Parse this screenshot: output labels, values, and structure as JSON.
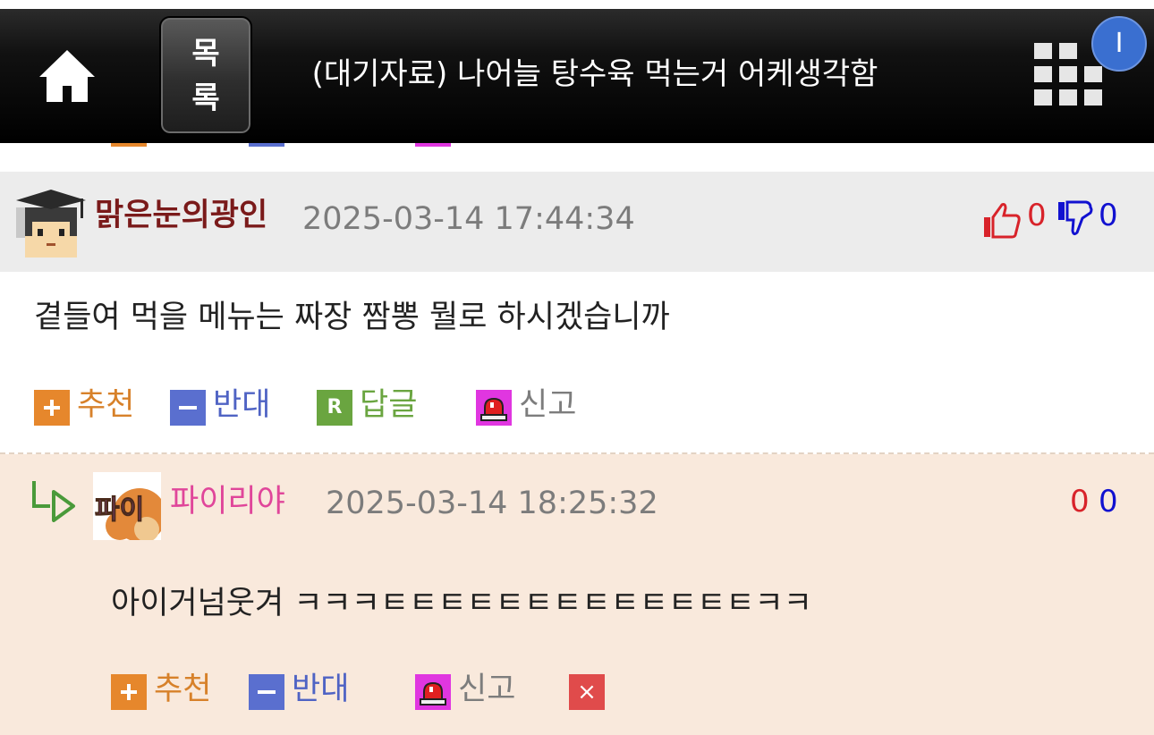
{
  "header": {
    "home_icon": "home-icon",
    "list_button": [
      "목",
      "록"
    ],
    "title": "(대기자료) 나어늘 탕수육 먹는거 어케생각함",
    "grid_icon": "grid-menu-icon",
    "user_badge": "I"
  },
  "comments": [
    {
      "nickname": "맑은눈의광인",
      "datetime": "2025-03-14 17:44:34",
      "upvotes": "0",
      "downvotes": "0",
      "body": "곁들여 먹을 메뉴는 짜장 짬뽕 뭘로 하시겠습니까",
      "actions": {
        "recommend": "추천",
        "oppose": "반대",
        "reply": "답글",
        "report": "신고"
      },
      "reply_icon_letter": "R"
    },
    {
      "nickname": "파이리야",
      "datetime": "2025-03-14 18:25:32",
      "upvotes": "0",
      "downvotes": "0",
      "body": "아이거넘웃겨 ㅋㅋㅋㅌㅌㅌㅌㅌㅌㅌㅌㅌㅌㅌㅌㅌㅋㅋ",
      "actions": {
        "recommend": "추천",
        "oppose": "반대",
        "report": "신고",
        "delete": "×"
      },
      "avatar_text": "파이"
    }
  ],
  "colors": {
    "recommend": "#d7812a",
    "oppose": "#4f63c4",
    "reply": "#6aa540",
    "report": "#7d7d7d",
    "up_count": "#d8232a",
    "down_count": "#1111d0",
    "nickname_1": "#7a1a1a",
    "nickname_2": "#e0469a",
    "reply_background": "#f9e9dc",
    "header_background": "#ececec"
  }
}
